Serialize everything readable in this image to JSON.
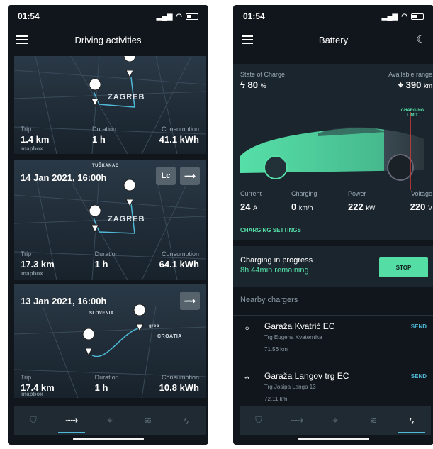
{
  "left": {
    "status_time": "01:54",
    "nav_title": "Driving activities",
    "trips": [
      {
        "date": "",
        "map_labels": [
          "ZAGREB"
        ],
        "trip_label": "Trip",
        "trip_value": "1.4 km",
        "duration_label": "Duration",
        "duration_value": "1 h",
        "consumption_label": "Consumption",
        "consumption_value": "41.1 kWh",
        "mapbox": "mapbox"
      },
      {
        "date": "14 Jan 2021, 16:00h",
        "top_label": "TUŠKANAC",
        "map_labels": [
          "ZAGREB"
        ],
        "badge": "Lc",
        "trip_label": "Trip",
        "trip_value": "17.3 km",
        "duration_label": "Duration",
        "duration_value": "1 h",
        "consumption_label": "Consumption",
        "consumption_value": "64.1 kWh",
        "mapbox": "mapbox"
      },
      {
        "date": "13 Jan 2021, 16:00h",
        "map_labels": [
          "SLOVENIA",
          "CROATIA",
          "greb"
        ],
        "trip_label": "Trip",
        "trip_value": "17.4 km",
        "duration_label": "Duration",
        "duration_value": "1 h",
        "consumption_label": "Consumption",
        "consumption_value": "10.8 kWh",
        "mapbox": "mapbox"
      }
    ],
    "tabs": [
      "car-icon",
      "steering-icon",
      "map-pin-icon",
      "wind-icon",
      "bolt-icon"
    ],
    "active_tab": 1
  },
  "right": {
    "status_time": "01:54",
    "nav_title": "Battery",
    "soc_label": "State of Charge",
    "soc_value": "80",
    "soc_unit": "%",
    "range_label": "Available range",
    "range_value": "390",
    "range_unit": "km",
    "charging_limit": "CHARGING LIMIT",
    "current_label": "Current",
    "current_value": "24",
    "current_unit": "A",
    "charging_label": "Charging",
    "charging_value": "0",
    "charging_unit": "km/h",
    "power_label": "Power",
    "power_value": "222",
    "power_unit": "kW",
    "voltage_label": "Voltage",
    "voltage_value": "220",
    "voltage_unit": "V",
    "charging_settings": "CHARGING SETTINGS",
    "progress_title": "Charging in progress",
    "progress_remaining": "8h 44min remaining",
    "stop_label": "STOP",
    "nearby_title": "Nearby chargers",
    "chargers": [
      {
        "name": "Garaža Kvatrić EC",
        "address": "Trg Eugena Kvaternika",
        "distance": "71.56 km",
        "action": "SEND"
      },
      {
        "name": "Garaža Langov trg EC",
        "address": "Trg Josipa Langa 13",
        "distance": "72.11 km",
        "action": "SEND"
      }
    ],
    "active_tab": 4
  },
  "colors": {
    "accent_green": "#54dea6",
    "accent_blue": "#4fb9d7",
    "background": "#10161b"
  }
}
